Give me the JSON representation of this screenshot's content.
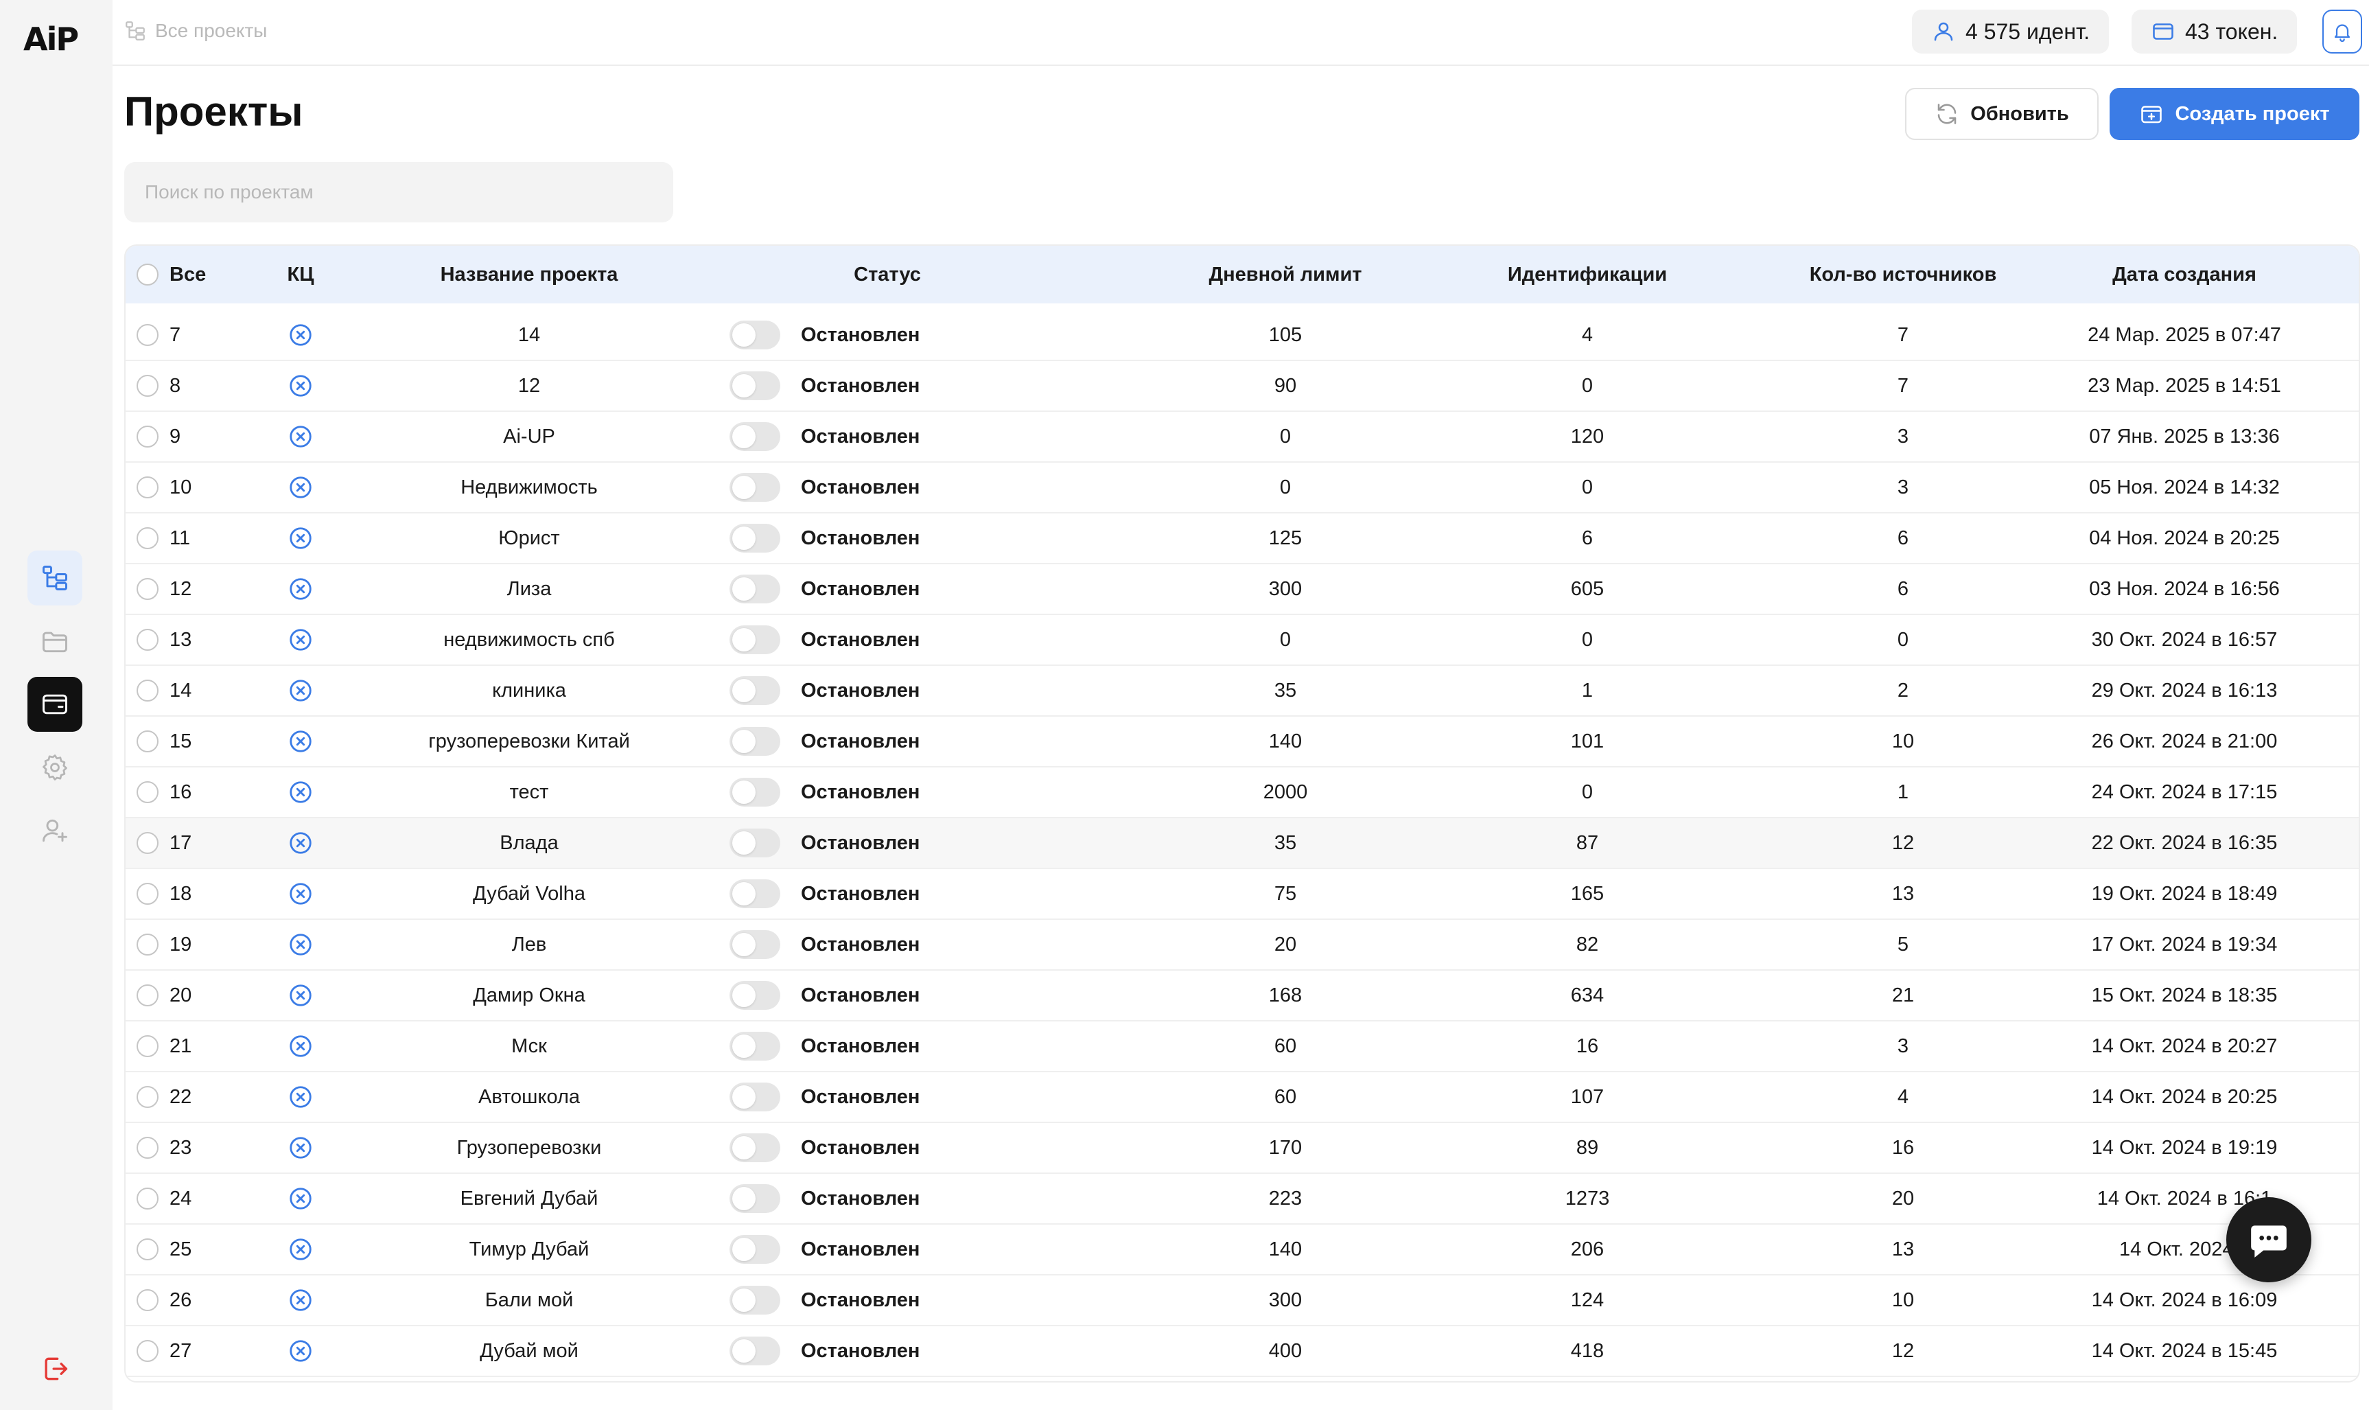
{
  "app": {
    "logo": "AiP"
  },
  "colors": {
    "accent": "#3b7ce6",
    "sidebar_bg": "#f4f4f4",
    "header_bg": "#eaf1fc",
    "logout": "#e53935"
  },
  "sidebar": {
    "items": [
      {
        "icon": "projects-tree-icon",
        "active": true
      },
      {
        "icon": "folder-icon"
      },
      {
        "icon": "wallet-icon",
        "selected": true
      },
      {
        "icon": "gear-icon"
      },
      {
        "icon": "add-user-icon"
      }
    ],
    "logout_icon": "logout-icon"
  },
  "topbar": {
    "breadcrumb": "Все проекты",
    "identifications": "4 575 идент.",
    "tokens": "43 токен."
  },
  "header": {
    "title": "Проекты",
    "refresh_label": "Обновить",
    "create_label": "Создать проект"
  },
  "search": {
    "placeholder": "Поиск по проектам"
  },
  "table": {
    "columns": {
      "all": "Все",
      "kc": "КЦ",
      "name": "Название проекта",
      "status": "Статус",
      "limit": "Дневной лимит",
      "ident": "Идентификации",
      "sources": "Кол-во источников",
      "date": "Дата создания"
    },
    "rows": [
      {
        "id": "7",
        "name": "14",
        "status": "Остановлен",
        "limit": "105",
        "ident": "4",
        "sources": "7",
        "date": "24 Мар. 2025 в 07:47"
      },
      {
        "id": "8",
        "name": "12",
        "status": "Остановлен",
        "limit": "90",
        "ident": "0",
        "sources": "7",
        "date": "23 Мар. 2025 в 14:51"
      },
      {
        "id": "9",
        "name": "Ai-UP",
        "status": "Остановлен",
        "limit": "0",
        "ident": "120",
        "sources": "3",
        "date": "07 Янв. 2025 в 13:36"
      },
      {
        "id": "10",
        "name": "Недвижимость",
        "status": "Остановлен",
        "limit": "0",
        "ident": "0",
        "sources": "3",
        "date": "05 Ноя. 2024 в 14:32"
      },
      {
        "id": "11",
        "name": "Юрист",
        "status": "Остановлен",
        "limit": "125",
        "ident": "6",
        "sources": "6",
        "date": "04 Ноя. 2024 в 20:25"
      },
      {
        "id": "12",
        "name": "Лиза",
        "status": "Остановлен",
        "limit": "300",
        "ident": "605",
        "sources": "6",
        "date": "03 Ноя. 2024 в 16:56"
      },
      {
        "id": "13",
        "name": "недвижимость спб",
        "status": "Остановлен",
        "limit": "0",
        "ident": "0",
        "sources": "0",
        "date": "30 Окт. 2024 в 16:57"
      },
      {
        "id": "14",
        "name": "клиника",
        "status": "Остановлен",
        "limit": "35",
        "ident": "1",
        "sources": "2",
        "date": "29 Окт. 2024 в 16:13"
      },
      {
        "id": "15",
        "name": "грузоперевозки Китай",
        "status": "Остановлен",
        "limit": "140",
        "ident": "101",
        "sources": "10",
        "date": "26 Окт. 2024 в 21:00"
      },
      {
        "id": "16",
        "name": "тест",
        "status": "Остановлен",
        "limit": "2000",
        "ident": "0",
        "sources": "1",
        "date": "24 Окт. 2024 в 17:15"
      },
      {
        "id": "17",
        "name": "Влада",
        "status": "Остановлен",
        "limit": "35",
        "ident": "87",
        "sources": "12",
        "date": "22 Окт. 2024 в 16:35"
      },
      {
        "id": "18",
        "name": "Дубай Volha",
        "status": "Остановлен",
        "limit": "75",
        "ident": "165",
        "sources": "13",
        "date": "19 Окт. 2024 в 18:49"
      },
      {
        "id": "19",
        "name": "Лев",
        "status": "Остановлен",
        "limit": "20",
        "ident": "82",
        "sources": "5",
        "date": "17 Окт. 2024 в 19:34"
      },
      {
        "id": "20",
        "name": "Дамир Окна",
        "status": "Остановлен",
        "limit": "168",
        "ident": "634",
        "sources": "21",
        "date": "15 Окт. 2024 в 18:35"
      },
      {
        "id": "21",
        "name": "Мск",
        "status": "Остановлен",
        "limit": "60",
        "ident": "16",
        "sources": "3",
        "date": "14 Окт. 2024 в 20:27"
      },
      {
        "id": "22",
        "name": "Автошкола",
        "status": "Остановлен",
        "limit": "60",
        "ident": "107",
        "sources": "4",
        "date": "14 Окт. 2024 в 20:25"
      },
      {
        "id": "23",
        "name": "Грузоперевозки",
        "status": "Остановлен",
        "limit": "170",
        "ident": "89",
        "sources": "16",
        "date": "14 Окт. 2024 в 19:19"
      },
      {
        "id": "24",
        "name": "Евгений Дубай",
        "status": "Остановлен",
        "limit": "223",
        "ident": "1273",
        "sources": "20",
        "date": "14 Окт. 2024 в 16:1"
      },
      {
        "id": "25",
        "name": "Тимур Дубай",
        "status": "Остановлен",
        "limit": "140",
        "ident": "206",
        "sources": "13",
        "date": "14 Окт. 2024 в"
      },
      {
        "id": "26",
        "name": "Бали мой",
        "status": "Остановлен",
        "limit": "300",
        "ident": "124",
        "sources": "10",
        "date": "14 Окт. 2024 в 16:09"
      },
      {
        "id": "27",
        "name": "Дубай мой",
        "status": "Остановлен",
        "limit": "400",
        "ident": "418",
        "sources": "12",
        "date": "14 Окт. 2024 в 15:45"
      }
    ]
  },
  "chat": {
    "icon": "chat-icon"
  }
}
